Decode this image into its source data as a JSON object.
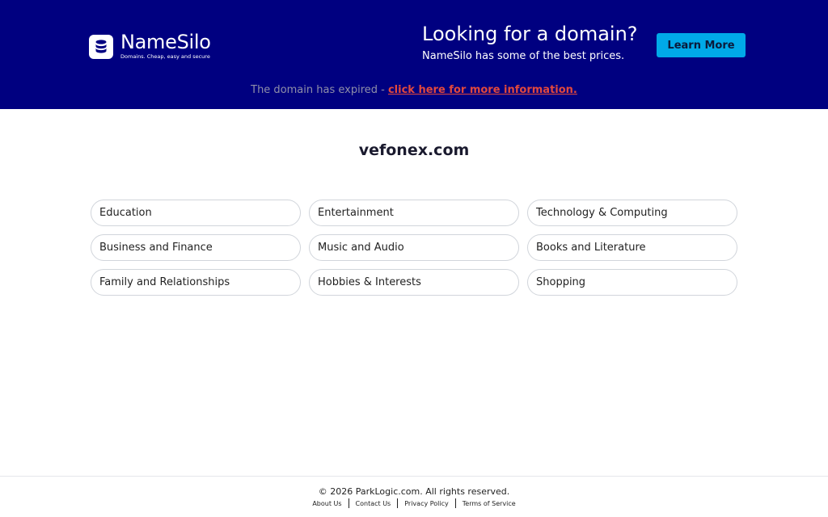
{
  "brand": {
    "name": "NameSilo",
    "tagline": "Domains. Cheap, easy and secure"
  },
  "promo": {
    "title": "Looking for a domain?",
    "subtitle": "NameSilo has some of the best prices.",
    "button_label": "Learn More"
  },
  "notice": {
    "text": "The domain has expired - ",
    "link_label": "click here for more information."
  },
  "domain": "vefonex.com",
  "categories": [
    "Education",
    "Entertainment",
    "Technology & Computing",
    "Business and Finance",
    "Music and Audio",
    "Books and Literature",
    "Family and Relationships",
    "Hobbies & Interests",
    "Shopping"
  ],
  "footer": {
    "copyright": "© 2026 ParkLogic.com. All rights reserved.",
    "links": [
      "About Us",
      "Contact Us",
      "Privacy Policy",
      "Terms of Service"
    ]
  },
  "colors": {
    "banner": "#000080",
    "button": "#00a9e8",
    "link": "#e2483d"
  }
}
